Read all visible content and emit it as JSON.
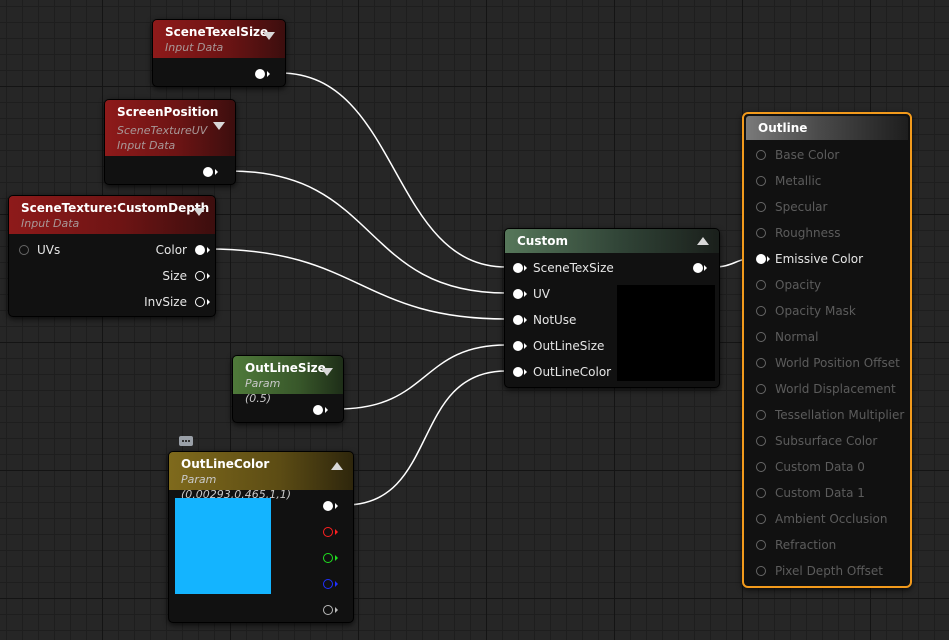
{
  "nodes": {
    "scene_texel_size": {
      "title": "SceneTexelSize",
      "subtitle": "Input Data"
    },
    "screen_position": {
      "title": "ScreenPosition",
      "subtitle1": "SceneTextureUV",
      "subtitle2": "Input Data"
    },
    "scene_texture": {
      "title": "SceneTexture:CustomDepth",
      "subtitle": "Input Data",
      "input_uvs": "UVs",
      "out_color": "Color",
      "out_size": "Size",
      "out_invsize": "InvSize"
    },
    "outline_size": {
      "title": "OutLineSize",
      "subtitle": "Param (0.5)"
    },
    "outline_color": {
      "title": "OutLineColor",
      "subtitle": "Param (0.00293,0.465,1,1)",
      "swatch_color": "#14b4ff"
    },
    "custom": {
      "title": "Custom",
      "inputs": [
        "SceneTexSize",
        "UV",
        "NotUse",
        "OutLineSize",
        "OutLineColor"
      ]
    },
    "outline": {
      "title": "Outline",
      "active_input": "Emissive Color",
      "pins": [
        "Base Color",
        "Metallic",
        "Specular",
        "Roughness",
        "Emissive Color",
        "Opacity",
        "Opacity Mask",
        "Normal",
        "World Position Offset",
        "World Displacement",
        "Tessellation Multiplier",
        "Subsurface Color",
        "Custom Data 0",
        "Custom Data 1",
        "Ambient Occlusion",
        "Refraction",
        "Pixel Depth Offset"
      ]
    }
  },
  "colors": {
    "wire": "#ffffff",
    "outline_border": "#f29a1c",
    "header_red": "#8e1a1a",
    "header_green": "#4f7a3a",
    "header_olive": "#7f6a1c"
  }
}
